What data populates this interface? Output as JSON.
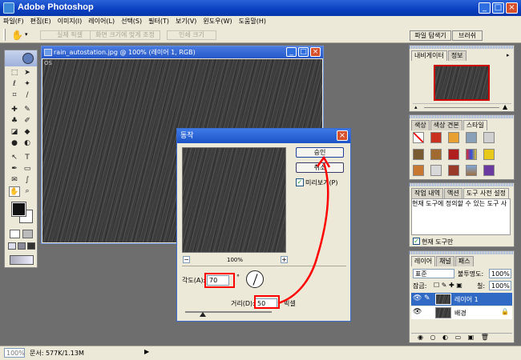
{
  "app": {
    "title": "Adobe Photoshop"
  },
  "menu": [
    "파일(F)",
    "편집(E)",
    "이미지(I)",
    "레이어(L)",
    "선택(S)",
    "필터(T)",
    "보기(V)",
    "윈도우(W)",
    "도움말(H)"
  ],
  "options": {
    "actual_pixels": "실제 픽셀",
    "fit_screen": "화면 크기에 맞게 조정",
    "print_size": "인쇄 크기",
    "file_browser": "파일 탐색기",
    "brushes": "브러쉬"
  },
  "document": {
    "title": "rain_autostation.jpg @ 100% (레이어 1, RGB)",
    "icon_text": "OS"
  },
  "dialog": {
    "title": "동작",
    "ok": "승인",
    "cancel": "취소",
    "preview_label": "미리보기(P)",
    "zoom_minus": "−",
    "zoom_plus": "+",
    "zoom": "100%",
    "angle_label": "각도(A):",
    "angle_value": "70",
    "angle_unit": "°",
    "distance_label": "거리(D):",
    "distance_value": "50",
    "distance_unit": "픽셀",
    "distance_level": 0.2
  },
  "navigator": {
    "tabs": [
      "내비게이터",
      "정보"
    ]
  },
  "color_panel": {
    "tabs": [
      "색상",
      "색상 견본",
      "스타일"
    ]
  },
  "preset_panel": {
    "tabs": [
      "작업 내역",
      "액션",
      "도구 사전 설정"
    ],
    "text": "현재 도구에 정의할 수 있는 도구 사",
    "checkbox": "현재 도구만"
  },
  "layers_panel": {
    "tabs": [
      "레이어",
      "채널",
      "패스"
    ],
    "blend_mode": "표준",
    "opacity_label": "불투명도:",
    "opacity_value": "100%",
    "lock_label": "잠금:",
    "fill_label": "칠:",
    "fill_value": "100%",
    "layers": [
      "레이어 1",
      "배경"
    ]
  },
  "status": {
    "zoom": "100%",
    "doc": "문서: 577K/1.13M"
  },
  "colors": {
    "accent_red": "#ff0000",
    "title_blue": "#0a3fc0"
  }
}
